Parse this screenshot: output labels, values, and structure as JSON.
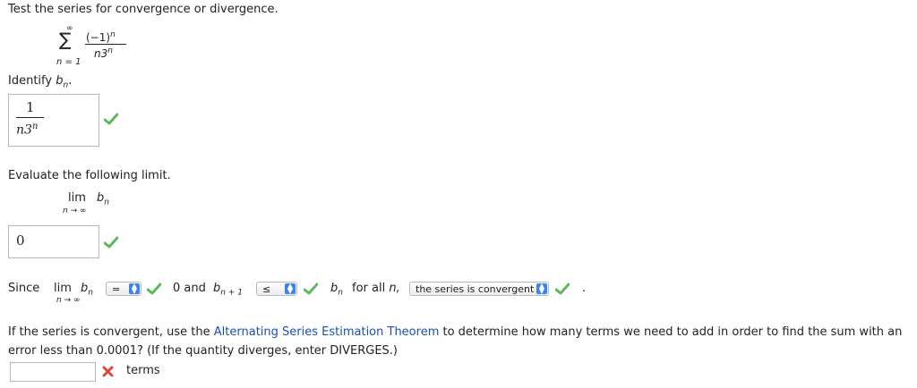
{
  "question": {
    "prompt": "Test the series for convergence or divergence.",
    "series": {
      "sigma": "∑",
      "upper": "∞",
      "lower": "n = 1",
      "numerator": "(−1)",
      "numerator_sup": "n",
      "denominator": "n3",
      "denominator_sup": "n"
    }
  },
  "part1": {
    "label_prefix": "Identify ",
    "label_var": "b",
    "label_sub": "n",
    "label_suffix": ".",
    "answer_num": "1",
    "answer_den": "n3",
    "answer_den_sup": "n",
    "status_icon": "check-icon"
  },
  "part2": {
    "label": "Evaluate the following limit.",
    "lim": "lim",
    "lim_under": "n → ∞",
    "var": "b",
    "var_sub": "n",
    "answer": "0",
    "status_icon": "check-icon"
  },
  "part3": {
    "since": "Since",
    "lim": "lim",
    "lim_under": "n → ∞",
    "var": "b",
    "var_sub": "n",
    "select1_value": "=",
    "and_text": "0 and",
    "b2": "b",
    "b2_sub": "n + 1",
    "select2_value": "≤",
    "b3": "b",
    "b3_sub": "n",
    "for_all": "for all",
    "for_all_var": "n,",
    "select3_value": "the series is convergent",
    "period": "."
  },
  "part4": {
    "text_before": "If the series is convergent, use the ",
    "link": "Alternating Series Estimation Theorem",
    "text_after": " to determine how many terms we need to add in order to find the sum with an",
    "line2": "error less than 0.0001? (If the quantity diverges, enter DIVERGES.)",
    "input_value": "",
    "status_icon": "x-icon",
    "units": "terms"
  },
  "colors": {
    "check": "#5cb85c",
    "cross": "#e0433b",
    "link": "#1a4fb8",
    "select_arrow": "#3b82f6"
  }
}
